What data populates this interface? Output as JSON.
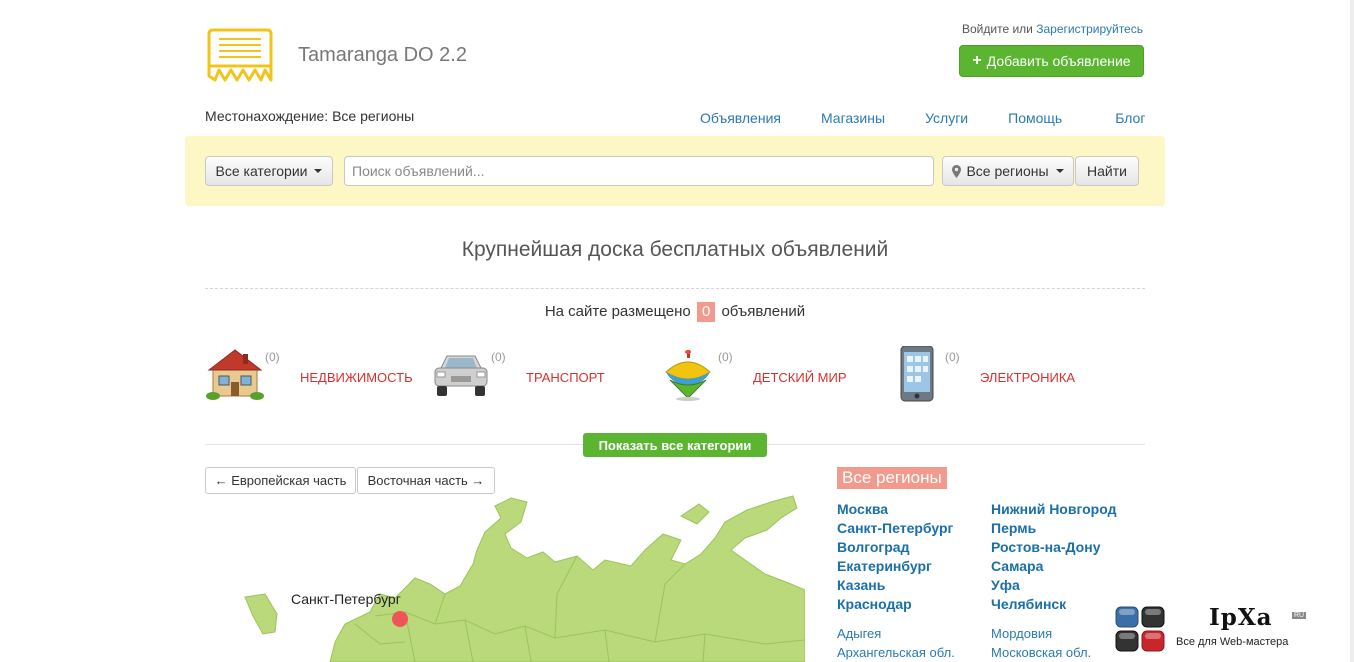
{
  "header": {
    "site_name": "Tamaranga DO 2.2",
    "login": "Войдите",
    "or": "или",
    "register": "Зарегистрируйтесь",
    "add_button": "Добавить объявление",
    "location": "Местонахождение: Все регионы"
  },
  "nav": [
    {
      "label": "Объявления"
    },
    {
      "label": "Магазины"
    },
    {
      "label": "Услуги"
    },
    {
      "label": "Помощь"
    },
    {
      "label": "Блог"
    }
  ],
  "search": {
    "category_button": "Все категории",
    "placeholder": "Поиск объявлений...",
    "region_button": "Все регионы",
    "find_button": "Найти"
  },
  "headline": "Крупнейшая доска бесплатных объявлений",
  "counter": {
    "prefix": "На сайте размещено",
    "count": "0",
    "suffix": "объявлений"
  },
  "categories": [
    {
      "icon": "house-icon",
      "count": "(0)",
      "label": "НЕДВИЖИМОСТЬ"
    },
    {
      "icon": "car-icon",
      "count": "(0)",
      "label": "ТРАНСПОРТ"
    },
    {
      "icon": "spinning-top-icon",
      "count": "(0)",
      "label": "ДЕТСКИЙ МИР"
    },
    {
      "icon": "phone-icon",
      "count": "(0)",
      "label": "ЭЛЕКТРОНИКА"
    }
  ],
  "show_all_categories": "Показать все категории",
  "map": {
    "european_button": "← Европейская часть",
    "eastern_button": "Восточная часть →",
    "city_label": "Санкт-Петербург",
    "land_color": "#b9d97a",
    "marker_color": "#f0545a"
  },
  "regions": {
    "title": "Все регионы",
    "main_col1": [
      "Москва",
      "Санкт-Петербург",
      "Волгоград",
      "Екатеринбург",
      "Казань",
      "Краснодар"
    ],
    "main_col2": [
      "Нижний Новгород",
      "Пермь",
      "Ростов-на-Дону",
      "Самара",
      "Уфа",
      "Челябинск"
    ],
    "other_col1": [
      "Адыгея",
      "Архангельская обл."
    ],
    "other_col2": [
      "Мордовия",
      "Московская обл."
    ]
  },
  "watermark": {
    "brand": "IpXa",
    "tag": "RU",
    "subtitle": "Все для Web-мастера"
  },
  "colors": {
    "accent_green": "#5cb531",
    "link_blue": "#2a7ab0",
    "category_red": "#d9302c",
    "badge_salmon": "#f29a8e",
    "search_bg": "#fdf7c6"
  }
}
